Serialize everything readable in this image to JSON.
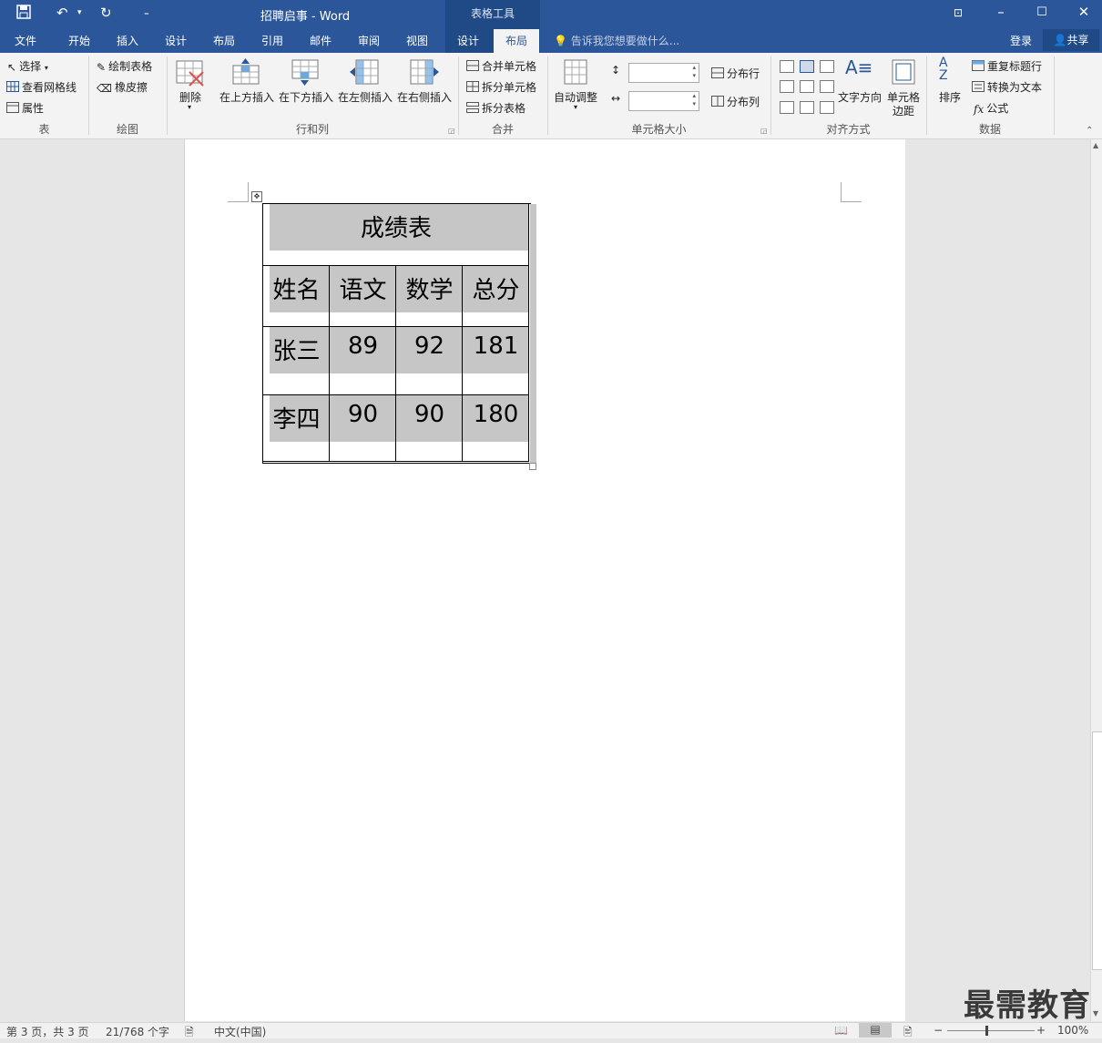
{
  "title_bar": {
    "doc_title": "招聘启事 - Word",
    "contextual_group": "表格工具",
    "qat_customize": "₹"
  },
  "tabs": [
    "文件",
    "开始",
    "插入",
    "设计",
    "布局",
    "引用",
    "邮件",
    "审阅",
    "视图"
  ],
  "context_tabs": [
    "设计",
    "布局"
  ],
  "tell_me": "告诉我您想要做什么...",
  "account": {
    "login": "登录",
    "share": "共享"
  },
  "ribbon": {
    "table_group": {
      "label": "表",
      "select": "选择",
      "view_gridlines": "查看网格线",
      "properties": "属性"
    },
    "draw_group": {
      "label": "绘图",
      "draw_table": "绘制表格",
      "eraser": "橡皮擦"
    },
    "rows_cols_group": {
      "label": "行和列",
      "delete": "删除",
      "insert_above": "在上方插入",
      "insert_below": "在下方插入",
      "insert_left": "在左侧插入",
      "insert_right": "在右侧插入"
    },
    "merge_group": {
      "label": "合并",
      "merge_cells": "合并单元格",
      "split_cells": "拆分单元格",
      "split_table": "拆分表格"
    },
    "cell_size_group": {
      "label": "单元格大小",
      "autofit": "自动调整",
      "distribute_rows": "分布行",
      "distribute_cols": "分布列"
    },
    "alignment_group": {
      "label": "对齐方式",
      "text_direction": "文字方向",
      "cell_margins_line1": "单元格",
      "cell_margins_line2": "边距"
    },
    "data_group": {
      "label": "数据",
      "sort": "排序",
      "repeat_header": "重复标题行",
      "convert_to_text": "转换为文本",
      "formula": "公式"
    }
  },
  "table": {
    "title": "成绩表",
    "headers": [
      "姓名",
      "语文",
      "数学",
      "总分"
    ],
    "rows": [
      [
        "张三",
        "89",
        "92",
        "181"
      ],
      [
        "李四",
        "90",
        "90",
        "180"
      ]
    ]
  },
  "status_bar": {
    "page": "第 3 页，共 3 页",
    "words": "21/768 个字",
    "language": "中文(中国)",
    "zoom": "100%"
  },
  "watermark": "最需教育"
}
